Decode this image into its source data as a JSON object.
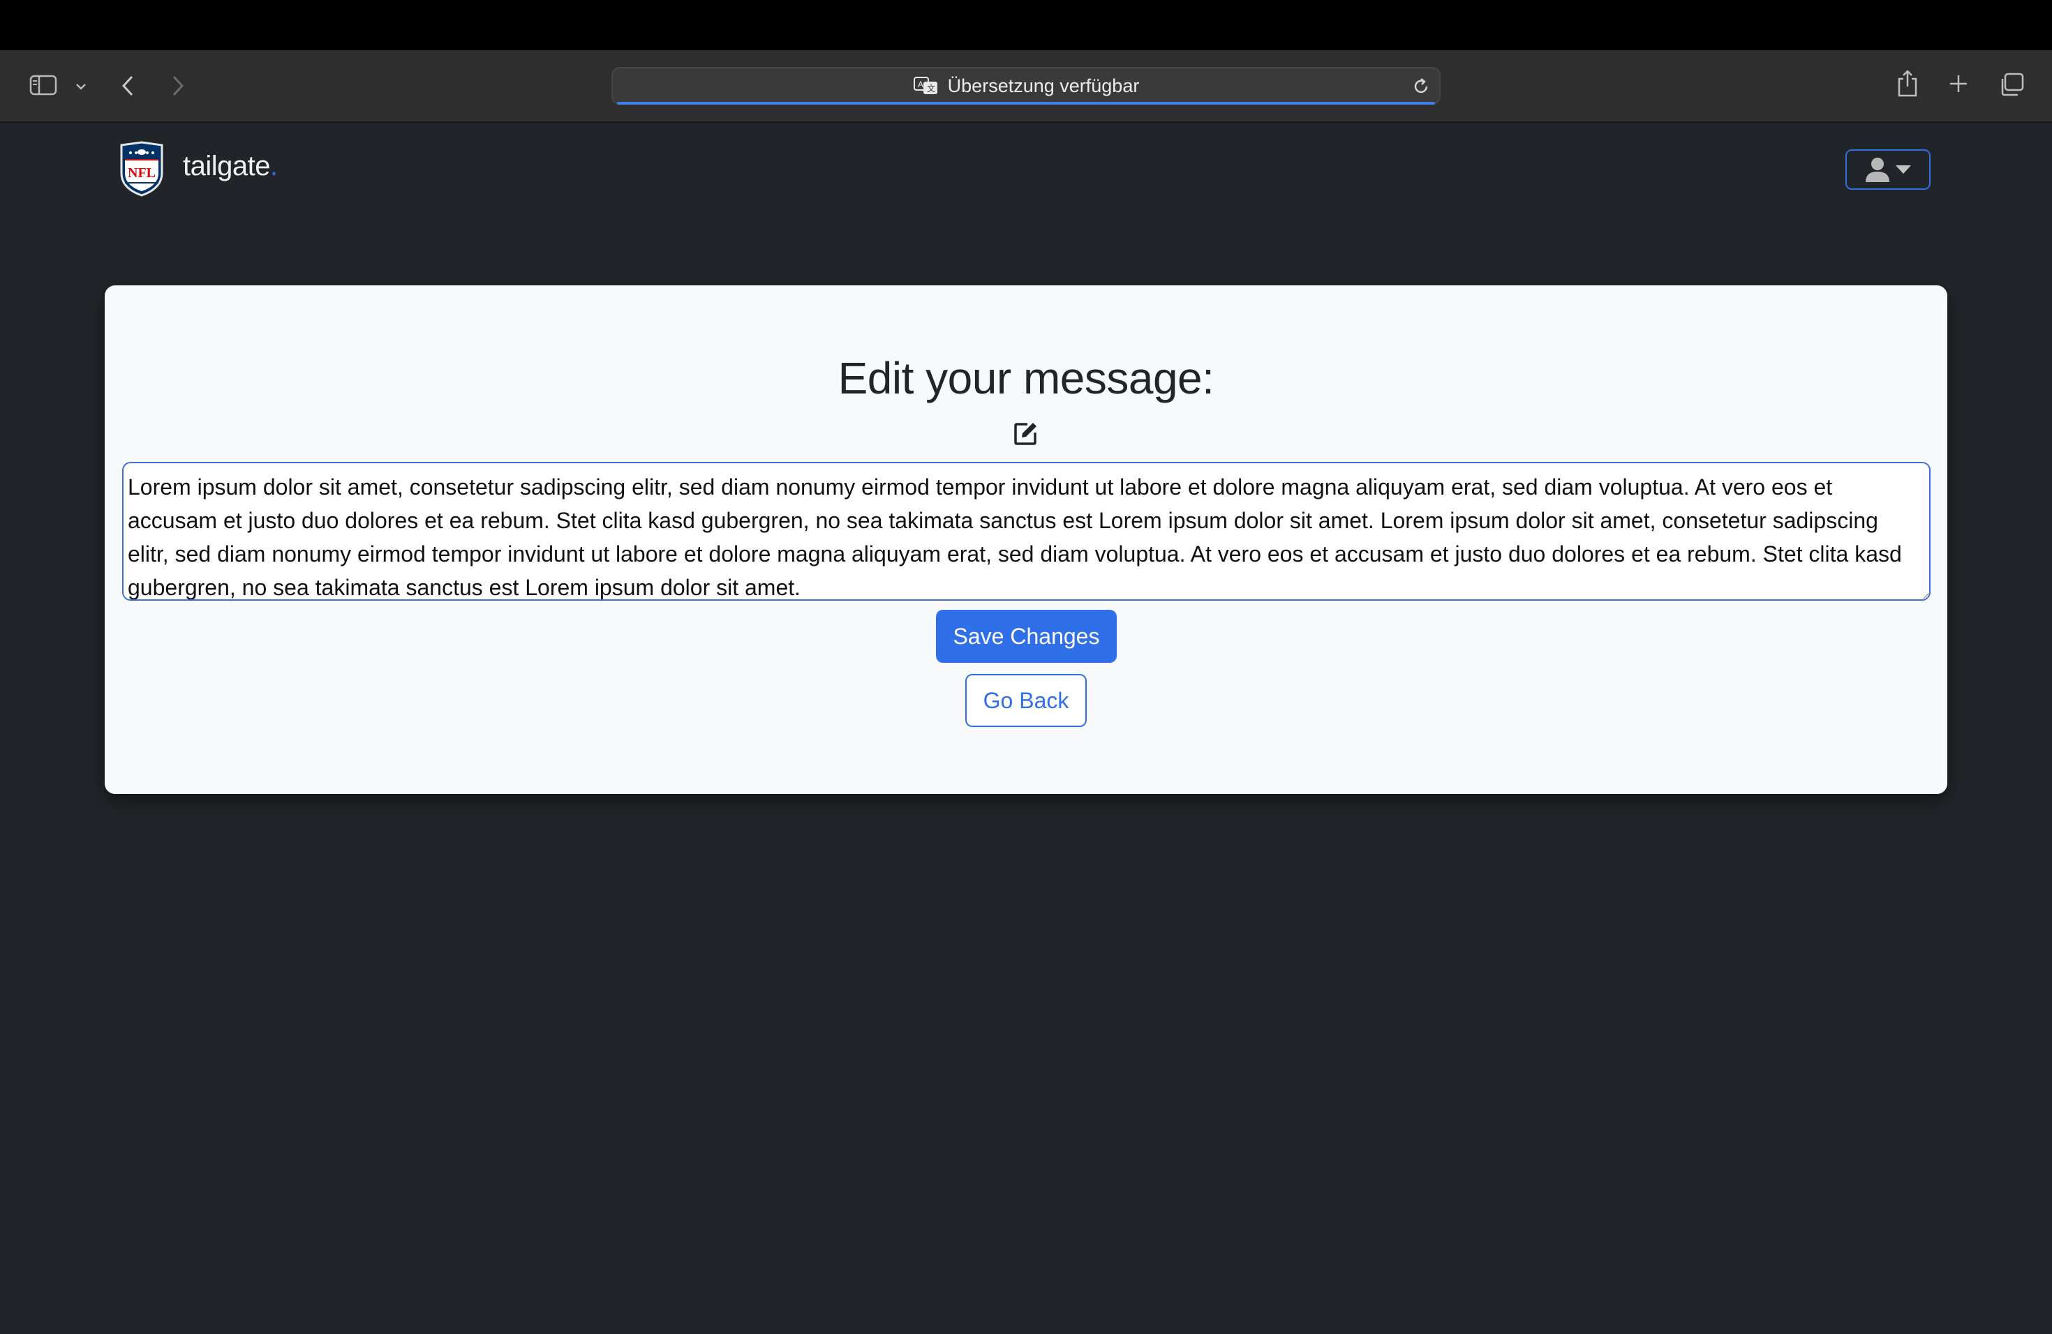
{
  "browser": {
    "address_text": "Übersetzung verfügbar",
    "icons": [
      "sidebar-icon",
      "chevron-down-icon",
      "back-icon",
      "forward-icon",
      "translate-icon",
      "reload-icon",
      "share-icon",
      "new-tab-icon",
      "tab-overview-icon"
    ]
  },
  "navbar": {
    "brand_name": "tailgate",
    "brand_dot": ".",
    "logo_icon": "nfl-shield-icon",
    "user_menu_icon": "user-icon"
  },
  "card": {
    "title": "Edit your message:",
    "edit_icon": "edit-icon",
    "message_value": "Lorem ipsum dolor sit amet, consetetur sadipscing elitr, sed diam nonumy eirmod tempor invidunt ut labore et dolore magna aliquyam erat, sed diam voluptua. At vero eos et accusam et justo duo dolores et ea rebum. Stet clita kasd gubergren, no sea takimata sanctus est Lorem ipsum dolor sit amet. Lorem ipsum dolor sit amet, consetetur sadipscing elitr, sed diam nonumy eirmod tempor invidunt ut labore et dolore magna aliquyam erat, sed diam voluptua. At vero eos et accusam et justo duo dolores et ea rebum. Stet clita kasd gubergren, no sea takimata sanctus est Lorem ipsum dolor sit amet.",
    "save_label": "Save Changes",
    "back_label": "Go Back"
  },
  "colors": {
    "page_bg": "#212529",
    "card_bg": "#f8f9fa",
    "accent": "#2f6fe8",
    "nfl_blue": "#013369",
    "nfl_red": "#d50a0a"
  }
}
